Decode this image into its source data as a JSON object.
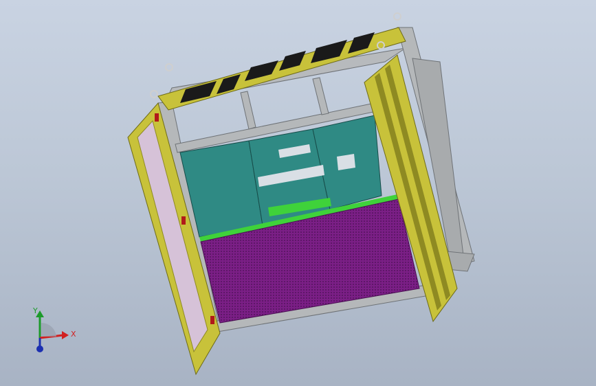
{
  "view": {
    "background_top": "#c9d3e2",
    "background_bottom": "#a8b3c4"
  },
  "model": {
    "frame_color": "#a9acae",
    "panel_yellow": "#c8c23a",
    "panel_yellow_dark": "#8e8a22",
    "vent_black": "#1a1a1a",
    "teal_panel": "#2f8a84",
    "teal_dark": "#1f6662",
    "purple_mesh": "#7b1f86",
    "green_strip": "#3fd23a",
    "inner_door_pink": "#d6c2d8",
    "lifting_eye": "#cfcfcf"
  },
  "triad": {
    "x_label": "X",
    "y_label": "Y",
    "x_color": "#d12020",
    "y_color": "#1c9a2a",
    "z_color": "#1b2fb0"
  }
}
